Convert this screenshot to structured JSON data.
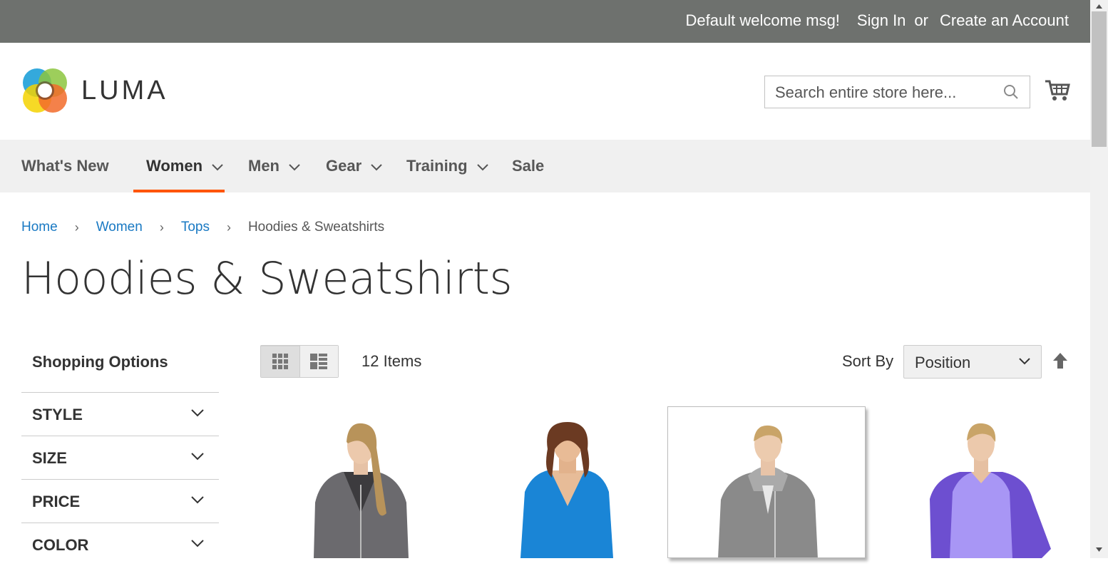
{
  "top_panel": {
    "welcome": "Default welcome msg!",
    "sign_in": "Sign In",
    "or": "or",
    "create_account": "Create an Account"
  },
  "header": {
    "logo_text": "LUMA",
    "search_placeholder": "Search entire store here..."
  },
  "nav": {
    "items": [
      {
        "label": "What's New",
        "dropdown": false
      },
      {
        "label": "Women",
        "dropdown": true,
        "active": true
      },
      {
        "label": "Men",
        "dropdown": true
      },
      {
        "label": "Gear",
        "dropdown": true
      },
      {
        "label": "Training",
        "dropdown": true
      },
      {
        "label": "Sale",
        "dropdown": false
      }
    ],
    "active_color": "#ff5501"
  },
  "breadcrumb": {
    "items": [
      "Home",
      "Women",
      "Tops"
    ],
    "current": "Hoodies & Sweatshirts"
  },
  "page_title": "Hoodies & Sweatshirts",
  "sidebar": {
    "title": "Shopping Options",
    "filters": [
      "STYLE",
      "SIZE",
      "PRICE",
      "COLOR"
    ]
  },
  "toolbar": {
    "view_modes": [
      "grid-icon",
      "list-icon"
    ],
    "active_mode": "grid",
    "items_count": "12 Items",
    "sort_label": "Sort By",
    "sort_value": "Position"
  },
  "products": [
    {
      "image": "woman-grey-hoodie",
      "color": "#6b6a6e"
    },
    {
      "image": "woman-blue-vneck",
      "color": "#1a85d6"
    },
    {
      "image": "woman-heather-grey-zip",
      "color": "#8a8a8a"
    },
    {
      "image": "woman-purple-raglan",
      "color": "#9f8cf0"
    }
  ],
  "colors": {
    "link": "#1979c3",
    "top_bar": "#6e716e",
    "nav_bg": "#f0f0f0"
  }
}
